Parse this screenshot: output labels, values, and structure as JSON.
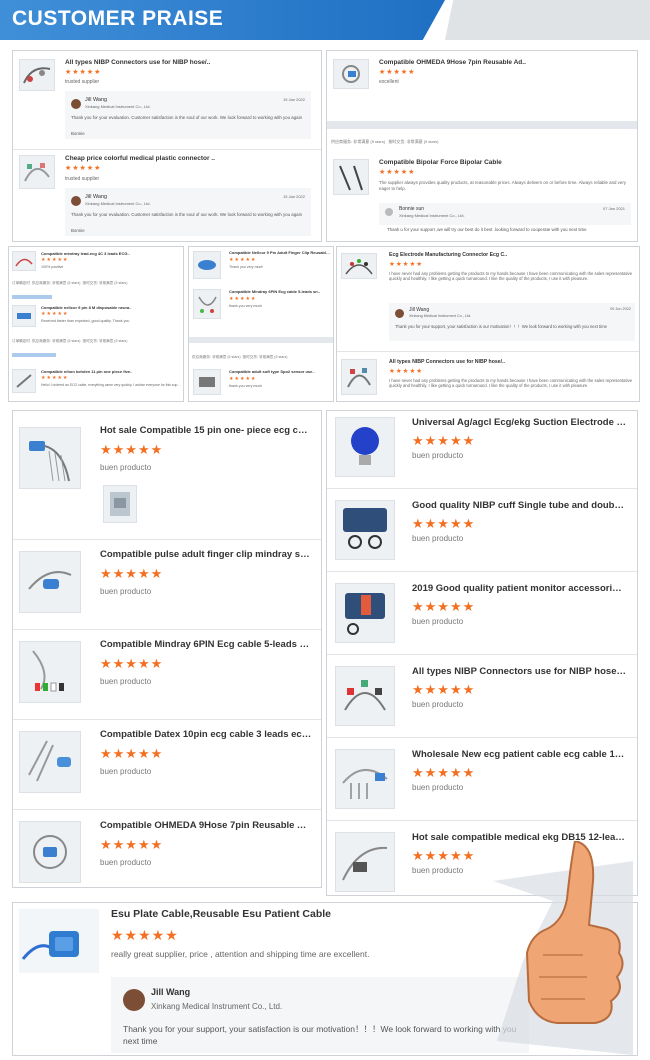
{
  "banner": {
    "title": "CUSTOMER PRAISE"
  },
  "stars": "★★★★★",
  "top_left": [
    {
      "title": "All types NIBP Connectors use for NIBP hose/..",
      "comment": "trusted supplier",
      "reply_name": "Jill Wang",
      "reply_company": "Xinkang Medical Instrument Co., Ltd.",
      "reply_date": "15 Jan 2022",
      "reply_text": "Thank you for your evaluation. Customer satisfaction is the soul of our work. We look forward to working with you again",
      "reply_sign": "Bonnie"
    },
    {
      "title": "Cheap price colorful medical plastic connector ..",
      "comment": "trusted supplier",
      "reply_name": "Jill Wang",
      "reply_company": "Xinkang Medical Instrument Co., Ltd.",
      "reply_date": "15 Jan 2022",
      "reply_text": "Thank you for your evaluation. Customer satisfaction is the soul of our work. We look forward to working with you again",
      "reply_sign": "Bonnie"
    }
  ],
  "top_right": {
    "item1": {
      "title": "Compatible OHMEDA 9Hose 7pin Reusable Ad..",
      "comment": "excellent"
    },
    "meta_row": {
      "a": "供应商服务: 非常满意",
      "b": "(5 stars)",
      "c": "按时交货: 非常满意",
      "d": "(5 stars)"
    },
    "item2": {
      "title": "Compatible Bipolar Force Bipolar Cable",
      "comment": "The supplier always provides quality products, at reasonable prices. Always delivers on or before time. Always reliable and very eager to help.",
      "reply_name": "Bonnie sun",
      "reply_company": "Xinkang Medical Instrument Co., Ltd.",
      "reply_date": "07 Jan 2021",
      "reply_text": "Thank u for your support ,we will try our best do it best .looking forward to cooperate with you next time"
    }
  },
  "mid_left": [
    {
      "title": "Compatible mindray lead-ecg 4C 3 leads ECG..",
      "comment": "100% positive"
    },
    {
      "title": "Compatible nellcor 9 pin 8 M disposable neura..",
      "comment": "Received faster than expected, good quality. Thank you"
    },
    {
      "title": "Compatible nihon kohden 11 pin one piece five..",
      "comment": "Hello! I ordered an ECG cable, everything came very quickly. I advise everyone for this supplier!"
    }
  ],
  "mid_left_meta": [
    {
      "a": "订单确定时",
      "b": "供应商服务: 非常满意",
      "c": "(5 stars)",
      "d": "按时交货: 非常满意",
      "e": "(5 stars)"
    },
    {
      "a": "订单确定时",
      "b": "供应商服务: 非常满意",
      "c": "(5 stars)",
      "d": "按时交货: 非常满意",
      "e": "(5 stars)"
    }
  ],
  "mid_center": [
    {
      "title": "Compatible Nellcor 9 Pin Adult Finger Clip Reusable S..",
      "comment": "Thank you very much"
    },
    {
      "title": "Compatible Mindray 6PIN Ecg cable 5-leads sn..",
      "comment": "thank you very much"
    },
    {
      "title": "Compatible adult soft type Spo2 sensor use..",
      "comment": "thank you very much"
    }
  ],
  "mid_center_meta": {
    "a": "供应商服务: 非常满意",
    "b": "(5 stars)",
    "c": "按时交货: 非常满意",
    "d": "(5 stars)"
  },
  "mid_right": {
    "item1": {
      "title": "Ecg Electrode Manufacturing Connector Ecg C..",
      "comment": "I have never had any problems getting the products to my hands because I have been communicating with the sales representative quickly and healthily. I like getting a quick turnaround. I like the quality of the products, I use it with pleasure.",
      "reply_name": "Jill Wang",
      "reply_company": "Xinkang Medical Instrument Co., Ltd.",
      "reply_date": "09 Jun 2022",
      "reply_text": "Thank you for your support, your satisfaction is our motivation！！！We look forward to working with you next time"
    },
    "item2": {
      "title": "All types NIBP Connectors use for NIBP hose/..",
      "comment": "I have never had any problems getting the products to my hands because I have been communicating with the sales representative quickly and healthily. I like getting a quick turnaround. I like the quality of the products, I use it with pleasure."
    }
  },
  "big_left": [
    {
      "title": "Hot sale Compatible 15 pin one- piece ecg cabl...",
      "comment": "buen producto"
    },
    {
      "title": "Compatible pulse adult finger clip mindray spo...",
      "comment": "buen producto"
    },
    {
      "title": "Compatible Mindray 6PIN Ecg cable 5-leads sn...",
      "comment": "buen producto"
    },
    {
      "title": "Compatible Datex 10pin ecg cable 3 leads ecg ...",
      "comment": "buen producto"
    },
    {
      "title": "Compatible OHMEDA 9Hose 7pin Reusable Ad...",
      "comment": "buen producto"
    }
  ],
  "big_right": [
    {
      "title": "Universal Ag/agcl Ecg/ekg Suction Electrode B...",
      "comment": "buen producto"
    },
    {
      "title": "Good quality NIBP cuff Single tube and double ...",
      "comment": "buen producto"
    },
    {
      "title": "2019 Good quality patient monitor accessories...",
      "comment": "buen producto"
    },
    {
      "title": "All types NIBP Connectors use for NIBP hose/...",
      "comment": "buen producto"
    },
    {
      "title": "Wholesale New ecg patient cable ecg cable 10 ...",
      "comment": "buen producto"
    },
    {
      "title": "Hot sale compatible medical ekg DB15 12-lead...",
      "comment": "buen producto"
    }
  ],
  "bottom": {
    "title": "Esu Plate Cable,Reusable Esu Patient Cable",
    "comment": "really great supplier, price , attention and shipping time are excellent.",
    "reply_name": "Jill Wang",
    "reply_company": "Xinkang Medical Instrument Co., Ltd.",
    "reply_text": "Thank you for your support, your satisfaction is our motivation！！！We look forward to working with you next time"
  },
  "colors": {
    "banner": "#2f7cd0",
    "star": "#f36f21",
    "border": "#cfd3d8"
  }
}
